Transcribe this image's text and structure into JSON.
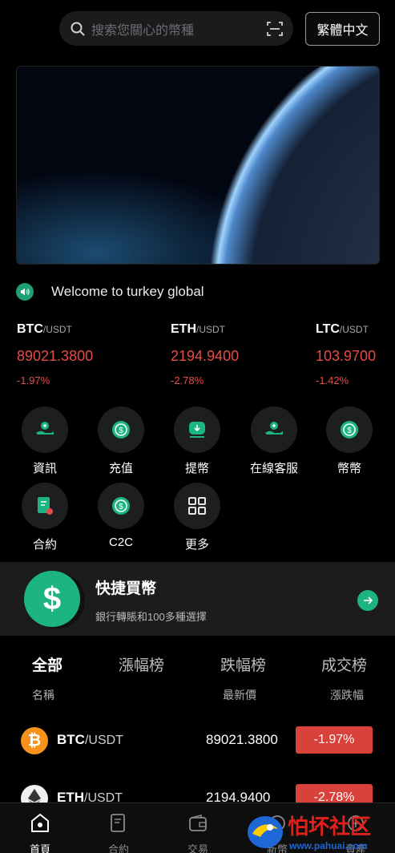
{
  "header": {
    "search_placeholder": "搜索您關心的幣種",
    "language_button": "繁體中文"
  },
  "notice": {
    "text": "Welcome to turkey global"
  },
  "tickers": [
    {
      "symbol": "BTC",
      "quote": "/USDT",
      "price": "89021.3800",
      "change": "-1.97%"
    },
    {
      "symbol": "ETH",
      "quote": "/USDT",
      "price": "2194.9400",
      "change": "-2.78%"
    },
    {
      "symbol": "LTC",
      "quote": "/USDT",
      "price": "103.9700",
      "change": "-1.42%"
    }
  ],
  "shortcuts": [
    {
      "label": "資訊",
      "icon": "info-hand-icon"
    },
    {
      "label": "充值",
      "icon": "deposit-coin-icon"
    },
    {
      "label": "提幣",
      "icon": "withdraw-icon"
    },
    {
      "label": "在線客服",
      "icon": "support-hand-icon"
    },
    {
      "label": "幣幣",
      "icon": "coin-icon"
    },
    {
      "label": "合約",
      "icon": "contract-icon"
    },
    {
      "label": "C2C",
      "icon": "c2c-coin-icon"
    },
    {
      "label": "更多",
      "icon": "grid-icon"
    }
  ],
  "quick_buy": {
    "title": "快捷買幣",
    "subtitle": "銀行轉賬和100多種選擇"
  },
  "market": {
    "tabs": [
      "全部",
      "漲幅榜",
      "跌幅榜",
      "成交榜"
    ],
    "active_tab": "全部",
    "columns": {
      "name": "名稱",
      "price": "最新價",
      "change": "漲跌幅"
    },
    "rows": [
      {
        "symbol": "BTC",
        "quote": "/USDT",
        "price": "89021.3800",
        "change": "-1.97%",
        "color": "#f7931a"
      },
      {
        "symbol": "ETH",
        "quote": "/USDT",
        "price": "2194.9400",
        "change": "-2.78%",
        "color": "#e8e8e8"
      }
    ]
  },
  "bottom_nav": [
    {
      "label": "首頁",
      "icon": "home-icon",
      "active": true
    },
    {
      "label": "合約",
      "icon": "contract-icon",
      "active": false
    },
    {
      "label": "交易",
      "icon": "wallet-icon",
      "active": false
    },
    {
      "label": "新幣",
      "icon": "new-coin-icon",
      "active": false
    },
    {
      "label": "資產",
      "icon": "assets-icon",
      "active": false
    }
  ],
  "watermark": {
    "text": "怕坏社区",
    "url_text": "www.pahuai.com"
  },
  "colors": {
    "accent": "#1db484",
    "down": "#e74b48",
    "down_badge": "#d9413b"
  }
}
